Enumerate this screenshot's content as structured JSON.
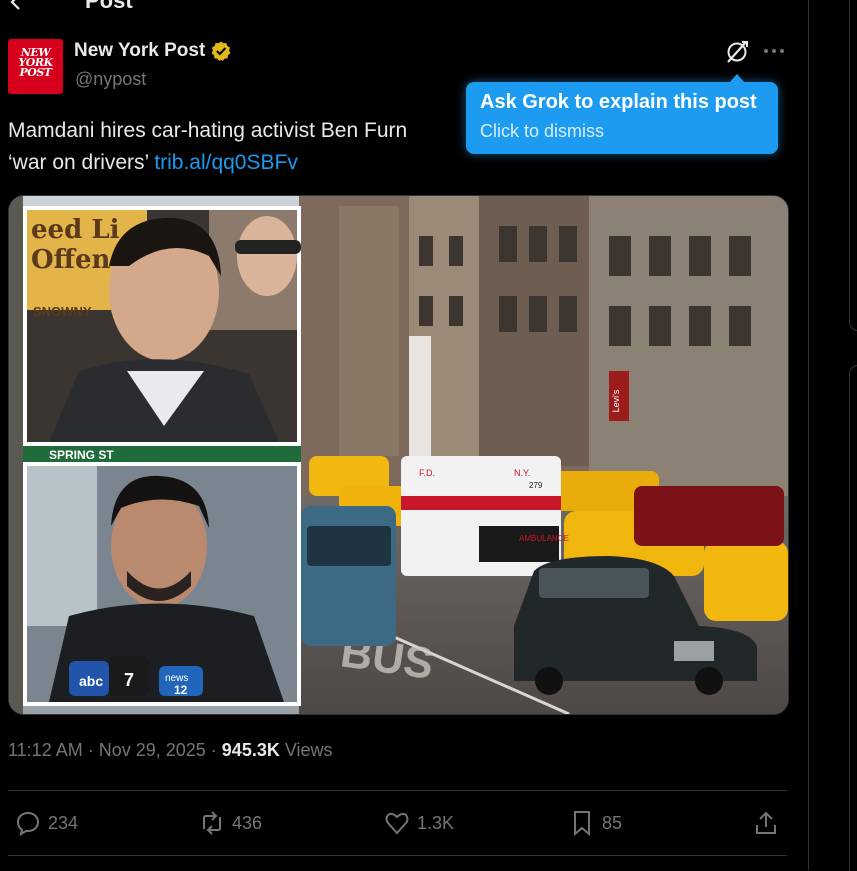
{
  "header": {
    "title": "Post"
  },
  "author": {
    "name": "New York Post",
    "handle": "@nypost",
    "logo_lines": [
      "NEW",
      "YORK",
      "POST"
    ]
  },
  "tweet": {
    "text_line1": "Mamdani hires car-hating activist Ben Furn",
    "text_line2_prefix": "‘war on drivers’ ",
    "link": "trib.al/qq0SBFv"
  },
  "tooltip": {
    "title": "Ask Grok to explain this post",
    "subtitle": "Click to dismiss"
  },
  "media": {
    "inset_top_sign": [
      "eed Li",
      "Offen",
      "SNOWNY"
    ],
    "street_sign": "SPRING ST",
    "ambulance_text": [
      "F.D.",
      "N.Y.",
      "AMBULANCE",
      "279"
    ],
    "store_sign": "Levi's",
    "bus_lane": "BUS",
    "mic_labels": [
      "abc",
      "7",
      "news",
      "12"
    ]
  },
  "meta": {
    "time": "11:12 AM",
    "date": "Nov 29, 2025",
    "views_count": "945.3K",
    "views_label": "Views"
  },
  "actions": {
    "replies": "234",
    "reposts": "436",
    "likes": "1.3K",
    "bookmarks": "85"
  },
  "colors": {
    "accent": "#1d9bf0",
    "verified": "#e2b719",
    "brand": "#d6001c"
  }
}
